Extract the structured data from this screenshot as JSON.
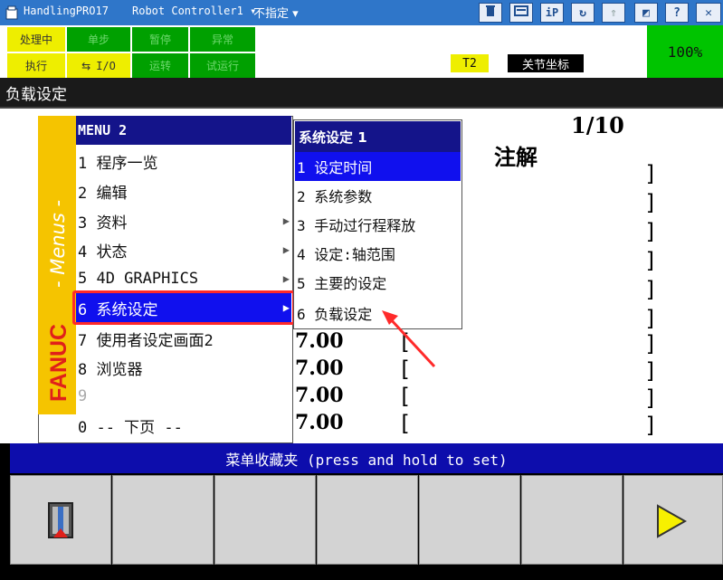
{
  "titlebar": {
    "app": "HandlingPRO17",
    "controller": "Robot Controller1",
    "unassigned": "不指定",
    "dropdown_arrow": "▾"
  },
  "status": {
    "row1": [
      "处理中",
      "单步",
      "暂停",
      "异常"
    ],
    "row2": [
      "执行",
      "I/O",
      "运转",
      "试运行"
    ],
    "tool": "T2",
    "coord": "关节坐标",
    "override": "100%"
  },
  "screen_title": "负载设定",
  "content": {
    "page": "1/10",
    "comment_header": "注解",
    "values": [
      "7.00",
      "7.00",
      "7.00",
      "7.00"
    ],
    "bracket_open": "[",
    "bracket_close": "]"
  },
  "menu": {
    "brand": "FANUC",
    "menus_label": "- Menus -",
    "header": "MENU  2",
    "items": [
      {
        "label": "1 程序一览"
      },
      {
        "label": "2 编辑"
      },
      {
        "label": "3 资料"
      },
      {
        "label": "4 状态"
      },
      {
        "label": "5 4D GRAPHICS"
      },
      {
        "label": "6 系统设定"
      },
      {
        "label": "7 使用者设定画面2"
      },
      {
        "label": "8 浏览器"
      },
      {
        "label": "9"
      },
      {
        "label": "0 -- 下页 --"
      }
    ],
    "arrow": "▶"
  },
  "submenu": {
    "header": "系统设定  1",
    "items": [
      {
        "label": "1 设定时间"
      },
      {
        "label": "2 系统参数"
      },
      {
        "label": "3 手动过行程释放"
      },
      {
        "label": "4 设定:轴范围"
      },
      {
        "label": "5 主要的设定"
      },
      {
        "label": "6 负载设定"
      }
    ]
  },
  "favorites_bar": "菜单收藏夹 (press and hold to set)",
  "colors": {
    "titlebar": "#2f76c9",
    "menu_header": "#14148a",
    "selection": "#1010ee",
    "highlight_border": "#ff2a2a",
    "fanuc_yellow": "#f5c400"
  }
}
